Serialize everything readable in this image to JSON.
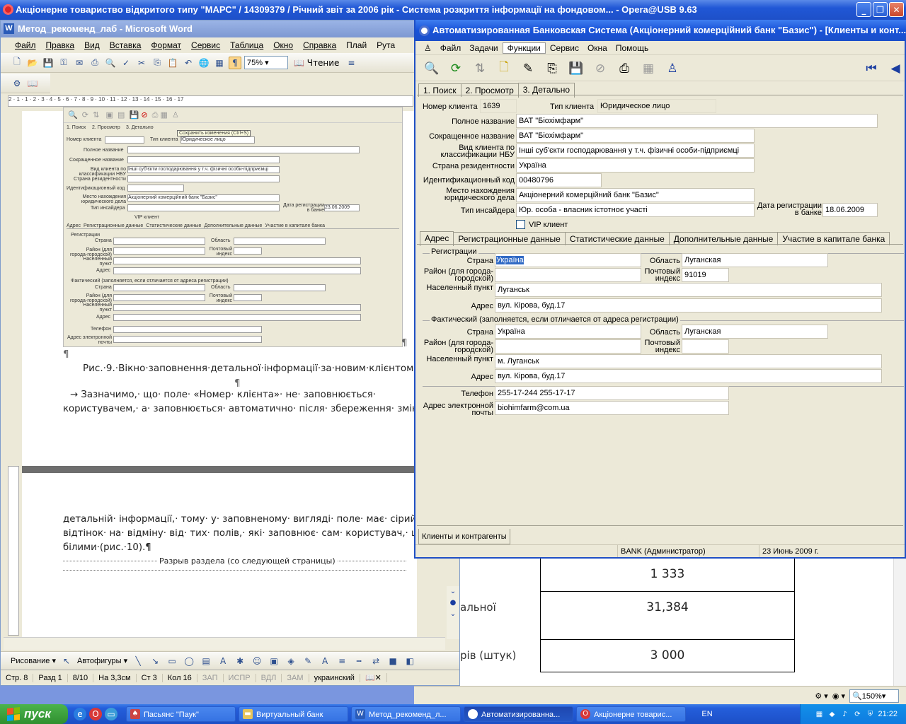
{
  "opera": {
    "title": "Акціонерне товариство відкритого типу \"МАРС\" / 14309379 / Річний звіт за 2006 рік - Система розкриття інформації на фондовом... - Opera@USB 9.63",
    "table": [
      "1 333",
      "31,384",
      "3 000"
    ],
    "left_text": [
      "альної",
      "рів (штук)"
    ],
    "zoom": "150%"
  },
  "word": {
    "title": "Метод_рекоменд_лаб - Microsoft Word",
    "menu": [
      "Файл",
      "Правка",
      "Вид",
      "Вставка",
      "Формат",
      "Сервис",
      "Таблица",
      "Окно",
      "Справка",
      "Плай",
      "Рута"
    ],
    "zoom": "75%",
    "reading": "Чтение",
    "ruler_text": "2 · 1 · 1 · 2 · 3 · 4 · 5 · 6 · 7 · 8 · 9 · 10 · 11 · 12 · 13 · 14 · 15 · 16 · 17",
    "caption": "Рис.·9.·Вікно·заповнення·детальної·інформації·за·новим·клієнтом¶",
    "pilcrow": "¶",
    "para1_line1": "→ Зазначимо,· що· поле· «Номер· клієнта»· не· заповнюється·",
    "para1_line2": "користувачем,· а· заповнюється· автоматично· після· збереження· змін· в·",
    "para2_line1": "детальній· інформації,· тому· у· заповненому· вигляді· поле· має· сірий·",
    "para2_line2": "відтінок· на· відміну· від· тих· полів,· які· заповнює· сам· користувач,· що· є·",
    "para2_line3": "білими·(рис.·10).¶",
    "section_break": "Разрыв раздела (со следующей страницы)",
    "draw_label": "Рисование",
    "autoshapes": "Автофигуры",
    "status": {
      "page": "Стр. 8",
      "section": "Разд 1",
      "pages": "8/10",
      "at": "На 3,3см",
      "line": "Ст 3",
      "col": "Кол 16",
      "rec": "ЗАП",
      "trk": "ИСПР",
      "ext": "ВДЛ",
      "ovr": "ЗАМ",
      "lang": "украинский"
    },
    "figure": {
      "tabs": [
        "1. Поиск",
        "2. Просмотр",
        "3. Детально"
      ],
      "tooltip": "Сохранить изменения (Ctrl+S)",
      "labels": [
        "Номер клиента",
        "Тип клиента",
        "Полное название",
        "Сокращенное название",
        "Вид клиента по классификации НБУ",
        "Страна резидентности",
        "Идентификационный код",
        "Место нахождения юридического дела",
        "Тип инсайдера",
        "Дата регистрации в банке",
        "VIP клиент"
      ],
      "client_type": "Юридическое лицо",
      "nbu": "Інші суб'єкти господарювання у т.ч. фізичні особи-підприємці",
      "place": "Акціонерний комерційний банк \"Базис\"",
      "date": "23.06.2009",
      "subtabs": [
        "Адрес",
        "Регистрационные данные",
        "Статистические данные",
        "Дополнительные данные",
        "Участие в капитале банка"
      ],
      "reg_title": "Регистрации",
      "fact_title": "Фактический (заполняется, если отличается от адреса регистрации)",
      "addr_labels": [
        "Страна",
        "Район (для города-городской)",
        "Населенный пункт",
        "Адрес",
        "Область",
        "Почтовый индекс"
      ],
      "phone": "Телефон",
      "email": "Адрес электронной почты"
    }
  },
  "bank": {
    "title": "Автоматизированная Банковская Система (Акціонерний комерційний банк \"Базис\") - [Клиенты и конт...",
    "menu": [
      "Файл",
      "Задачи",
      "Функции",
      "Сервис",
      "Окна",
      "Помощь"
    ],
    "tabs": [
      "1. Поиск",
      "2. Просмотр",
      "3. Детально"
    ],
    "client_no_label": "Номер клиента",
    "client_no": "1639",
    "client_type_label": "Тип клиента",
    "client_type": "Юридическое лицо",
    "full_name_label": "Полное название",
    "full_name": "ВАТ \"Біохімфарм\"",
    "short_name_label": "Сокращенное название",
    "short_name": "ВАТ \"Біохімфарм\"",
    "nbu_label": "Вид клиента по классификации НБУ",
    "nbu": "Інші суб'єкти господарювання у т.ч. фізичні особи-підприємці",
    "country_label": "Страна резидентности",
    "country": "Україна",
    "id_label": "Идентификационный код",
    "id_code": "00480796",
    "place_label": "Место нахождения юридического дела",
    "place": "Акціонерний комерційний банк \"Базис\"",
    "insider_label": "Тип инсайдера",
    "insider": "Юр. особа - власник істотноє участі",
    "reg_date_label": "Дата регистрации в банке",
    "reg_date": "18.06.2009",
    "vip_label": "VIP клиент",
    "subtabs": [
      "Адрес",
      "Регистрационные данные",
      "Статистические данные",
      "Дополнительные данные",
      "Участие в капитале банка"
    ],
    "reg": {
      "title": "Регистрации",
      "country_label": "Страна",
      "country": "Україна",
      "district_label": "Район (для города-городской)",
      "district": "",
      "locality_label": "Населенный пункт",
      "locality": "Луганськ",
      "address_label": "Адрес",
      "address": "вул. Кірова, буд.17",
      "region_label": "Область",
      "region": "Луганская",
      "zip_label": "Почтовый индекс",
      "zip": "91019"
    },
    "fact": {
      "title": "Фактический (заполняется, если отличается от адреса регистрации)",
      "country_label": "Страна",
      "country": "Україна",
      "district_label": "Район (для города-городской)",
      "district": "",
      "locality_label": "Населенный пункт",
      "locality": "м. Луганськ",
      "address_label": "Адрес",
      "address": "вул. Кірова, буд.17",
      "region_label": "Область",
      "region": "Луганская",
      "zip_label": "Почтовый индекс",
      "zip": ""
    },
    "phone_label": "Телефон",
    "phone": "255-17-244 255-17-17",
    "email_label": "Адрес электронной почты",
    "email": "biohimfarm@com.ua",
    "bottom_tab": "Клиенты и контрагенты",
    "status_user": "BANK (Администратор)",
    "status_date": "23 Июнь 2009 г."
  },
  "taskbar": {
    "start": "пуск",
    "tasks": [
      "Пасьянс \"Паук\"",
      "Виртуальный банк",
      "Метод_рекоменд_л...",
      "Автоматизированна...",
      "Акціонерне товарис..."
    ],
    "lang": "EN",
    "clock": "21:22"
  }
}
